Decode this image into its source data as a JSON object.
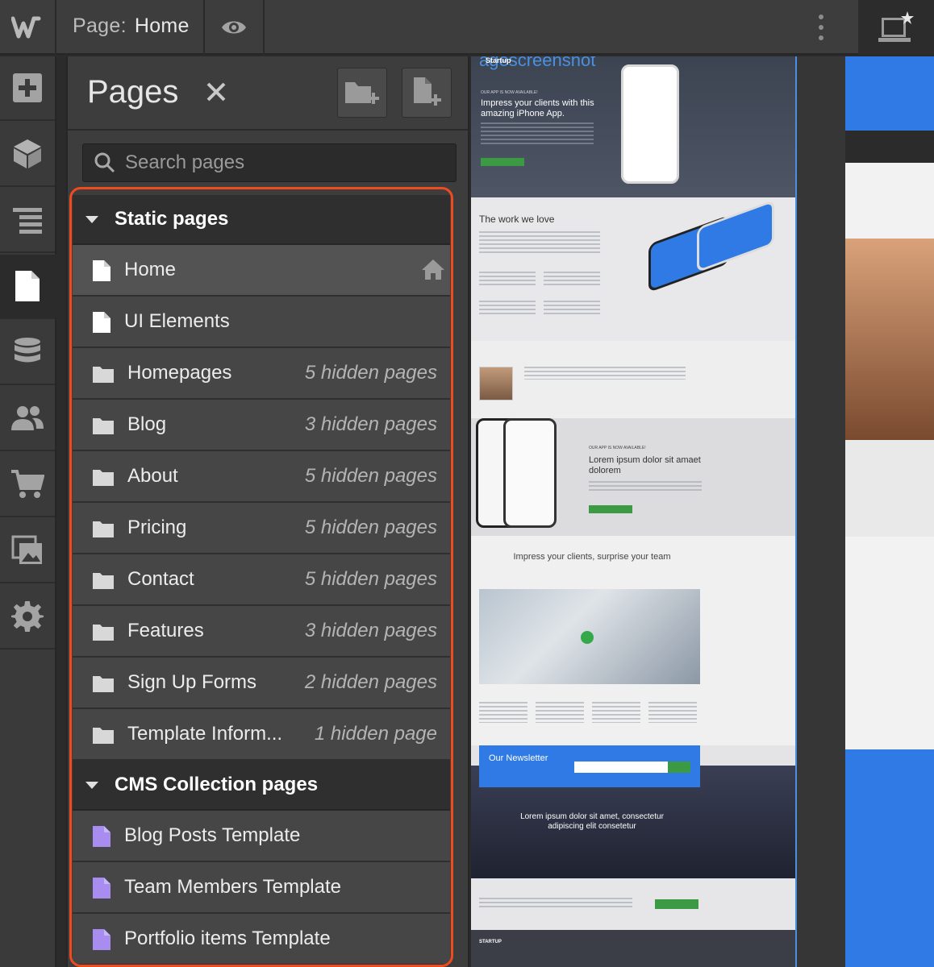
{
  "topbar": {
    "page_key": "Page:",
    "page_value": "Home",
    "icons": [
      "webflow-logo-icon",
      "preview-eye-icon",
      "more-vertical-icon",
      "device-laptop-icon"
    ]
  },
  "rail": {
    "items": [
      {
        "name": "add-elements",
        "icon": "plus-icon"
      },
      {
        "name": "symbols",
        "icon": "cube-icon"
      },
      {
        "name": "navigator",
        "icon": "layers-icon"
      },
      {
        "name": "pages",
        "icon": "page-icon",
        "active": true
      },
      {
        "name": "cms",
        "icon": "database-icon"
      },
      {
        "name": "users",
        "icon": "users-icon"
      },
      {
        "name": "ecommerce",
        "icon": "cart-icon"
      },
      {
        "name": "assets",
        "icon": "images-icon"
      },
      {
        "name": "settings",
        "icon": "gear-icon"
      }
    ]
  },
  "panel": {
    "title": "Pages",
    "search_placeholder": "Search pages",
    "static_section": "Static pages",
    "cms_section": "CMS Collection pages",
    "static_pages": [
      {
        "name": "Home",
        "type": "page",
        "home": true
      },
      {
        "name": "UI Elements",
        "type": "page"
      }
    ],
    "folders": [
      {
        "name": "Homepages",
        "meta": "5 hidden pages"
      },
      {
        "name": "Blog",
        "meta": "3 hidden pages"
      },
      {
        "name": "About",
        "meta": "5 hidden pages"
      },
      {
        "name": "Pricing",
        "meta": "5 hidden pages"
      },
      {
        "name": "Contact",
        "meta": "5 hidden pages"
      },
      {
        "name": "Features",
        "meta": "3 hidden pages"
      },
      {
        "name": "Sign Up Forms",
        "meta": "2 hidden pages"
      },
      {
        "name": "Template Inform...",
        "meta": "1 hidden page"
      }
    ],
    "cms_pages": [
      {
        "name": "Blog Posts Template"
      },
      {
        "name": "Team Members Template"
      },
      {
        "name": "Portfolio items Template"
      }
    ]
  },
  "canvas": {
    "hero_title": "agescreenshot",
    "hero_brand": "Startup",
    "hero_kicker": "OUR APP IS NOW AVAILABLE!",
    "hero_heading": "Impress your clients with this amazing iPhone App.",
    "work_heading": "The work we love",
    "app_kicker": "OUR APP IS NOW AVAILABLE!",
    "app_heading": "Lorem ipsum dolor sit amaet dolorem",
    "impress_heading": "Impress your clients, surprise your team",
    "newsletter": "Our Newsletter",
    "city_heading": "Lorem ipsum dolor sit amet, consectetur adipiscing elit consetetur",
    "footer_brand": "STARTUP"
  },
  "colors": {
    "accent": "#4a90e2",
    "highlight": "#f04a1f",
    "cms_icon": "#a98cf0",
    "green": "#3c9a45"
  }
}
